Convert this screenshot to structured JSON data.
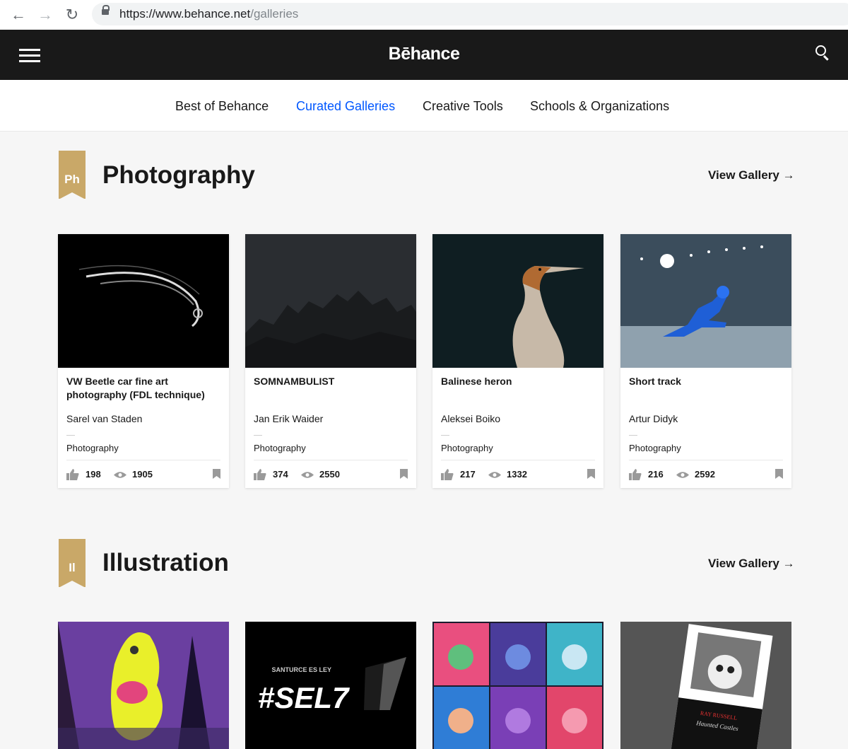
{
  "browser": {
    "url_main": "https://www.behance.net",
    "url_path": "/galleries"
  },
  "header": {
    "logo": "Bēhance"
  },
  "subnav": {
    "items": [
      {
        "label": "Best of Behance",
        "active": false
      },
      {
        "label": "Curated Galleries",
        "active": true
      },
      {
        "label": "Creative Tools",
        "active": false
      },
      {
        "label": "Schools & Organizations",
        "active": false
      }
    ]
  },
  "colors": {
    "accent": "#0057ff",
    "badge_gold": "#c9a868",
    "header_bg": "#191919"
  },
  "sections": [
    {
      "badge": "Ph",
      "title": "Photography",
      "view_gallery": "View Gallery →",
      "cards": [
        {
          "title": "VW Beetle car fine art photography (FDL technique)",
          "owner": "Sarel van Staden",
          "field": "Photography",
          "likes": "198",
          "views": "1905"
        },
        {
          "title": "SOMNAMBULIST",
          "owner": "Jan Erik Waider",
          "field": "Photography",
          "likes": "374",
          "views": "2550"
        },
        {
          "title": "Balinese heron",
          "owner": "Aleksei Boiko",
          "field": "Photography",
          "likes": "217",
          "views": "1332"
        },
        {
          "title": "Short track",
          "owner": "Artur Didyk",
          "field": "Photography",
          "likes": "216",
          "views": "2592"
        }
      ]
    },
    {
      "badge": "Il",
      "title": "Illustration",
      "view_gallery": "View Gallery →",
      "covers": [
        {
          "alt": "colorful figure illustration"
        },
        {
          "text_big": "#SEL7",
          "text_small": "SANTURCE ES LEY"
        },
        {
          "alt": "character grid illustration"
        },
        {
          "text_small": "RAY RUSSELL",
          "text_book": "Haunted Castles"
        }
      ]
    }
  ]
}
